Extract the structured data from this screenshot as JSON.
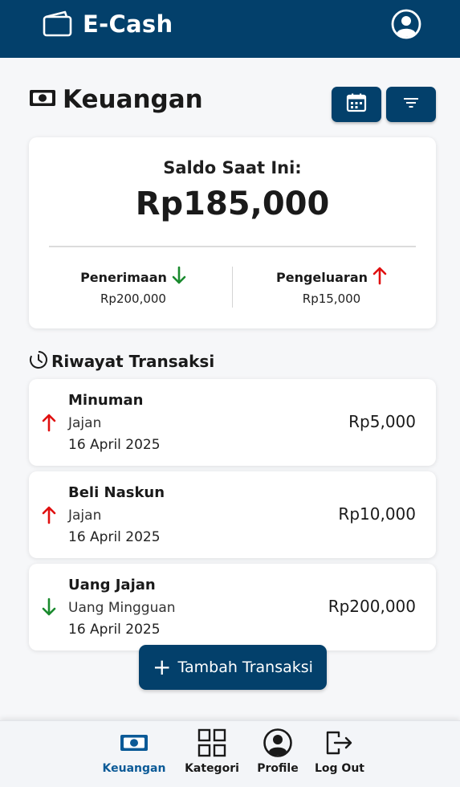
{
  "app": {
    "name": "E-Cash"
  },
  "page": {
    "title": "Keuangan"
  },
  "balance": {
    "label": "Saldo Saat Ini:",
    "amount": "Rp185,000",
    "income_label": "Penerimaan",
    "income_value": "Rp200,000",
    "expense_label": "Pengeluaran",
    "expense_value": "Rp15,000"
  },
  "history": {
    "title": "Riwayat Transaksi",
    "items": [
      {
        "name": "Minuman",
        "category": "Jajan",
        "date": "16 April 2025",
        "amount": "Rp5,000",
        "direction": "out"
      },
      {
        "name": "Beli Naskun",
        "category": "Jajan",
        "date": "16 April 2025",
        "amount": "Rp10,000",
        "direction": "out"
      },
      {
        "name": "Uang Jajan",
        "category": "Uang Mingguan",
        "date": "16 April 2025",
        "amount": "Rp200,000",
        "direction": "in"
      }
    ]
  },
  "actions": {
    "add_label": "Tambah Transaksi"
  },
  "nav": [
    {
      "label": "Keuangan",
      "icon": "money-icon",
      "active": true
    },
    {
      "label": "Kategori",
      "icon": "grid-icon",
      "active": false
    },
    {
      "label": "Profile",
      "icon": "user-icon",
      "active": false
    },
    {
      "label": "Log Out",
      "icon": "logout-icon",
      "active": false
    }
  ],
  "colors": {
    "primary": "#03406b",
    "income": "#1a8a2e",
    "expense": "#e01010",
    "nav_active": "#0b5a97"
  }
}
